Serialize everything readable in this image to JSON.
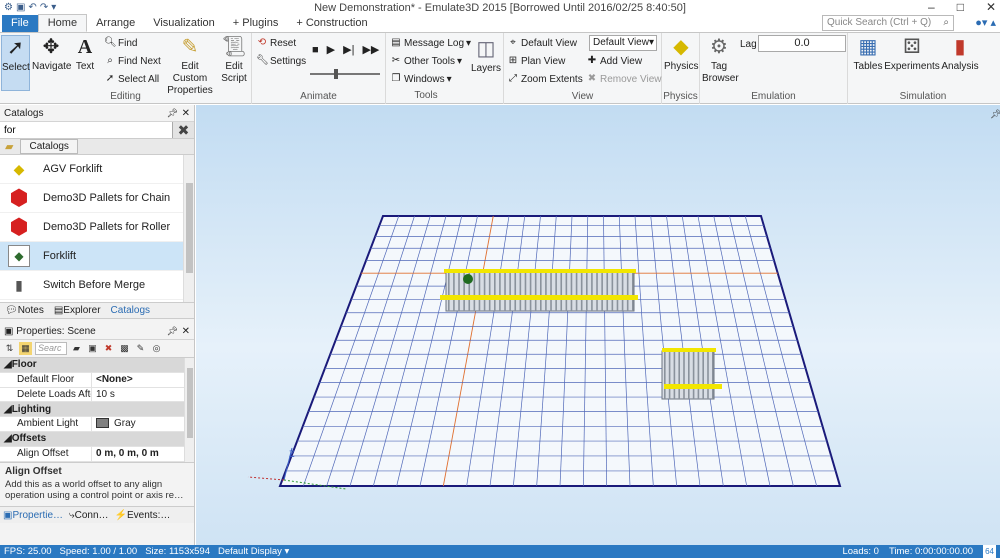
{
  "window": {
    "title": "New Demonstration* - Emulate3D 2015 [Borrowed Until 2016/02/25 8:40:50]"
  },
  "tabs": [
    "File",
    "Home",
    "Arrange",
    "Visualization",
    "+ Plugins",
    "+ Construction"
  ],
  "quick_search": {
    "placeholder": "Quick Search (Ctrl + Q)"
  },
  "ribbon": {
    "editing": {
      "label": "Editing",
      "select": "Select",
      "navigate": "Navigate",
      "text": "Text",
      "find": "Find",
      "find_next": "Find Next",
      "select_all": "Select All",
      "edit_custom": "Edit Custom Properties",
      "edit_script": "Edit Script"
    },
    "animate": {
      "label": "Animate",
      "reset": "Reset",
      "settings": "Settings"
    },
    "tools": {
      "label": "Tools",
      "message_log": "Message Log",
      "other_tools": "Other Tools",
      "windows": "Windows",
      "layers": "Layers"
    },
    "view": {
      "label": "View",
      "default_view": "Default View",
      "plan_view": "Plan View",
      "zoom_extents": "Zoom Extents",
      "view_select": "Default View",
      "add_view": "Add View",
      "remove_view": "Remove View"
    },
    "physics": {
      "label": "Physics",
      "physics": "Physics"
    },
    "emulation": {
      "label": "Emulation",
      "tag_browser": "Tag Browser",
      "lag_label": "Lag",
      "lag_value": "0.0"
    },
    "simulation": {
      "label": "Simulation",
      "tables": "Tables",
      "experiments": "Experiments",
      "analysis": "Analysis"
    }
  },
  "catalogs": {
    "title": "Catalogs",
    "search_value": "for",
    "tab": "Catalogs",
    "items": [
      "AGV Forklift",
      "Demo3D Pallets for Chain",
      "Demo3D Pallets for Roller",
      "Forklift",
      "Switch Before Merge"
    ],
    "bottom_tabs": [
      "Notes",
      "Explorer",
      "Catalogs"
    ]
  },
  "properties": {
    "title": "Properties: Scene",
    "search_placeholder": "Searc",
    "groups": [
      {
        "name": "Floor",
        "rows": [
          {
            "key": "Default Floor",
            "value": "<None>"
          },
          {
            "key": "Delete Loads Afte",
            "value": "10 s"
          }
        ]
      },
      {
        "name": "Lighting",
        "rows": [
          {
            "key": "Ambient Light",
            "value": "Gray"
          }
        ]
      },
      {
        "name": "Offsets",
        "rows": [
          {
            "key": "Align Offset",
            "value": "0 m, 0 m, 0 m"
          }
        ]
      }
    ],
    "desc_title": "Align Offset",
    "desc_text": "Add this as a world offset to any align operation using a control point or axis re…",
    "tabs": [
      "Propertie…",
      "Conn…",
      "Events:…"
    ]
  },
  "status": {
    "fps": "FPS: 25.00",
    "speed": "Speed: 1.00 / 1.00",
    "size": "Size: 1153x594",
    "display": "Default Display",
    "loads": "Loads: 0",
    "time": "Time: 0:00:00:00.00"
  },
  "colors": {
    "accent": "#2b79c2",
    "floor": "#f4f8fc",
    "grid": "#5068b8",
    "conveyor_yellow": "#f2e600"
  }
}
